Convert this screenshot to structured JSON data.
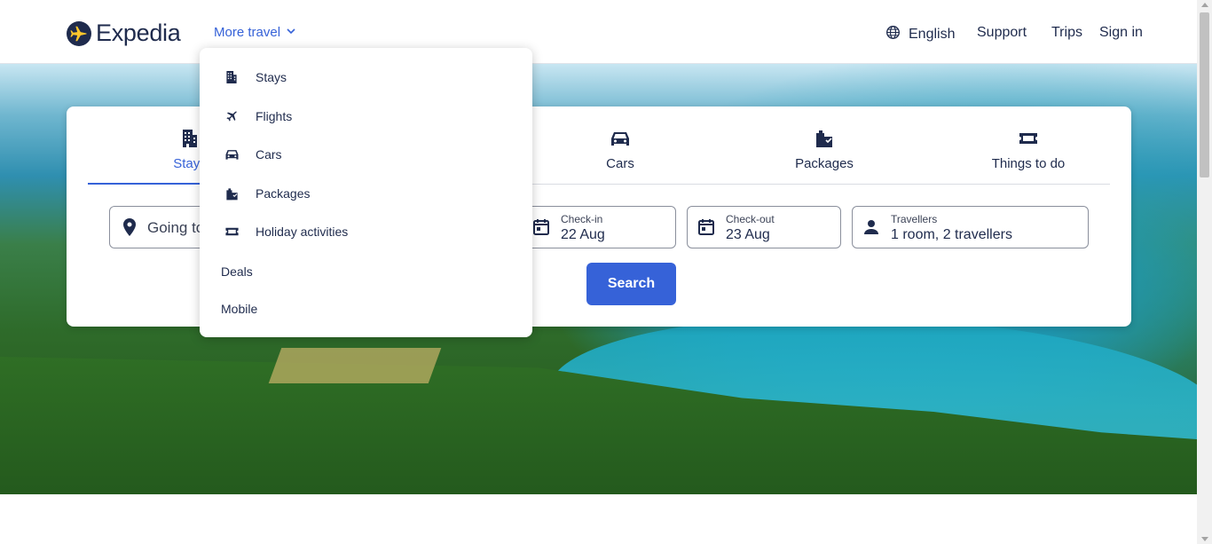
{
  "header": {
    "logo_text": "Expedia",
    "more_travel": "More travel",
    "language": "English",
    "support": "Support",
    "trips": "Trips",
    "sign_in": "Sign in"
  },
  "dropdown": {
    "items": [
      {
        "label": "Stays",
        "icon": "building-icon"
      },
      {
        "label": "Flights",
        "icon": "plane-icon"
      },
      {
        "label": "Cars",
        "icon": "car-icon"
      },
      {
        "label": "Packages",
        "icon": "packages-icon"
      },
      {
        "label": "Holiday activities",
        "icon": "ticket-icon"
      }
    ],
    "deals": "Deals",
    "mobile": "Mobile"
  },
  "search": {
    "tabs": [
      {
        "label": "Stays",
        "icon": "building-icon",
        "active": true
      },
      {
        "label": "Cars",
        "icon": "car-icon"
      },
      {
        "label": "Packages",
        "icon": "packages-icon"
      },
      {
        "label": "Things to do",
        "icon": "ticket-icon"
      }
    ],
    "going_to": "Going to",
    "check_in": {
      "label": "Check-in",
      "value": "22 Aug"
    },
    "check_out": {
      "label": "Check-out",
      "value": "23 Aug"
    },
    "travellers": {
      "label": "Travellers",
      "value": "1 room, 2 travellers"
    },
    "search_button": "Search"
  },
  "colors": {
    "brand": "#1f2b4d",
    "accent": "#3662d8"
  }
}
